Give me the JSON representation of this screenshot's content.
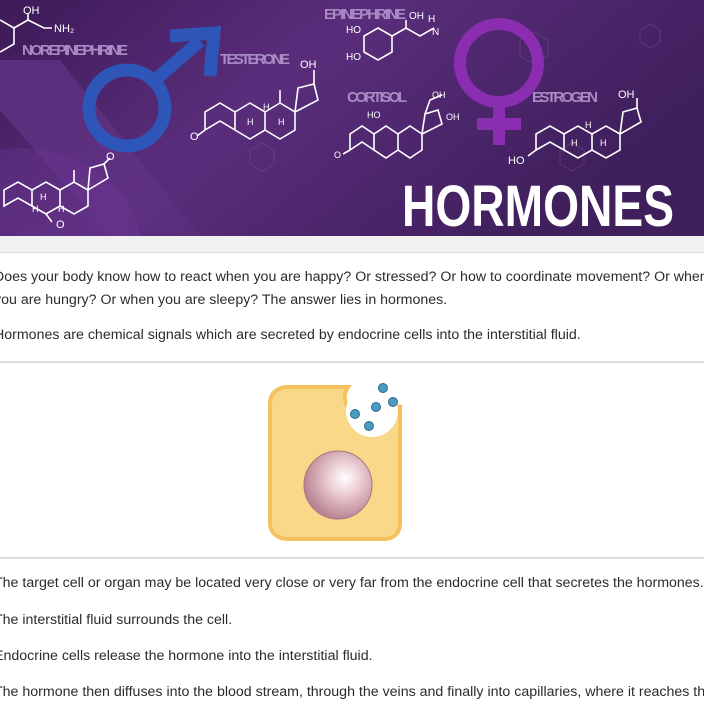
{
  "banner": {
    "title": "HORMONES",
    "labels": {
      "norepinephrine": "NOREPINEPHRINE",
      "testerone": "TESTERONE",
      "epinephrine": "EPINEPHRINE",
      "cortisol": "CORTISOL",
      "estrogen": "ESTROGEN"
    },
    "chem": {
      "oh": "OH",
      "nh2": "NH₂",
      "ho": "HO",
      "h": "H",
      "n": "N",
      "o": "O"
    },
    "colors": {
      "background": "#4a2466",
      "male_symbol": "#2d56b8",
      "female_symbol": "#8a2db0",
      "title": "#ffffff"
    }
  },
  "intro": {
    "line1": "Does your body know how to react when you are happy? Or stressed? Or how to coordinate movement? Or when",
    "line2": "you are hungry? Or when you are sleepy? The answer lies in hormones.",
    "line3": "Hormones are chemical signals which are secreted by endocrine cells into the interstitial fluid."
  },
  "steps": [
    "The target cell or organ may be located very close or very far from the endocrine cell that secretes the hormones.",
    "The interstitial fluid surrounds the cell.",
    "Endocrine cells release the hormone into the interstitial fluid.",
    "The hormone then diffuses into the blood stream, through the veins and finally into capillaries, where it reaches the"
  ],
  "colors": {
    "cell_fill": "#f9d889",
    "cell_border": "#f4c15d",
    "nucleus": "#c89aa6",
    "hormone_dots": "#4b9ac0"
  }
}
